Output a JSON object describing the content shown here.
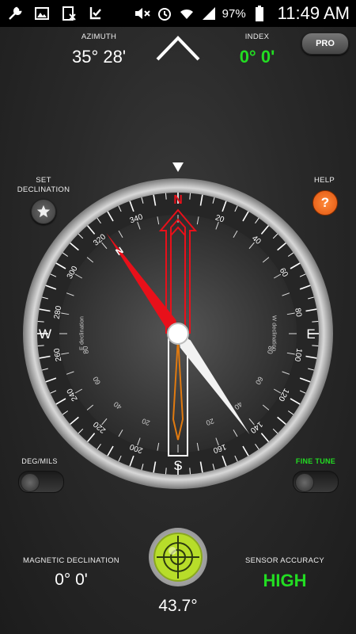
{
  "status_bar": {
    "icons_left": [
      "wrench-icon",
      "image-icon",
      "xls-file-icon",
      "download-check-icon"
    ],
    "icons_right": [
      "mute-icon",
      "alarm-icon",
      "wifi-icon",
      "signal-icon",
      "battery-icon"
    ],
    "battery": "97%",
    "time": "11:49 AM"
  },
  "header": {
    "azimuth_label": "AZIMUTH",
    "azimuth_value": "35° 28'",
    "index_label": "INDEX",
    "index_value": "0° 0'",
    "pro_label": "PRO"
  },
  "controls": {
    "set_declination_line1": "SET",
    "set_declination_line2": "DECLINATION",
    "help_label": "HELP",
    "help_symbol": "?",
    "deg_mils_label": "DEG/MILS",
    "fine_tune_label": "FINE TUNE"
  },
  "compass": {
    "heading_deg": 35.5,
    "cardinals": {
      "N": "N",
      "E": "E",
      "S": "S",
      "W": "W"
    },
    "needle_n_label": "N",
    "e_declination": "E declination",
    "w_declination": "W declination",
    "outer_ticks": [
      "20",
      "40",
      "60",
      "80",
      "100",
      "120",
      "140",
      "160",
      "200",
      "220",
      "240",
      "260",
      "280",
      "300",
      "320",
      "340"
    ],
    "inner_ticks": [
      "20",
      "40",
      "60",
      "80",
      "80",
      "60",
      "40",
      "20"
    ]
  },
  "footer": {
    "magnetic_declination_label": "MAGNETIC DECLINATION",
    "magnetic_declination_value": "0° 0'",
    "tilt_value": "43.7°",
    "sensor_accuracy_label": "SENSOR ACCURACY",
    "sensor_accuracy_value": "HIGH"
  },
  "colors": {
    "accent_green": "#22dd22",
    "needle_red": "#e8101a",
    "help_orange": "#f26b1d",
    "level_green": "#b7dd2a"
  }
}
